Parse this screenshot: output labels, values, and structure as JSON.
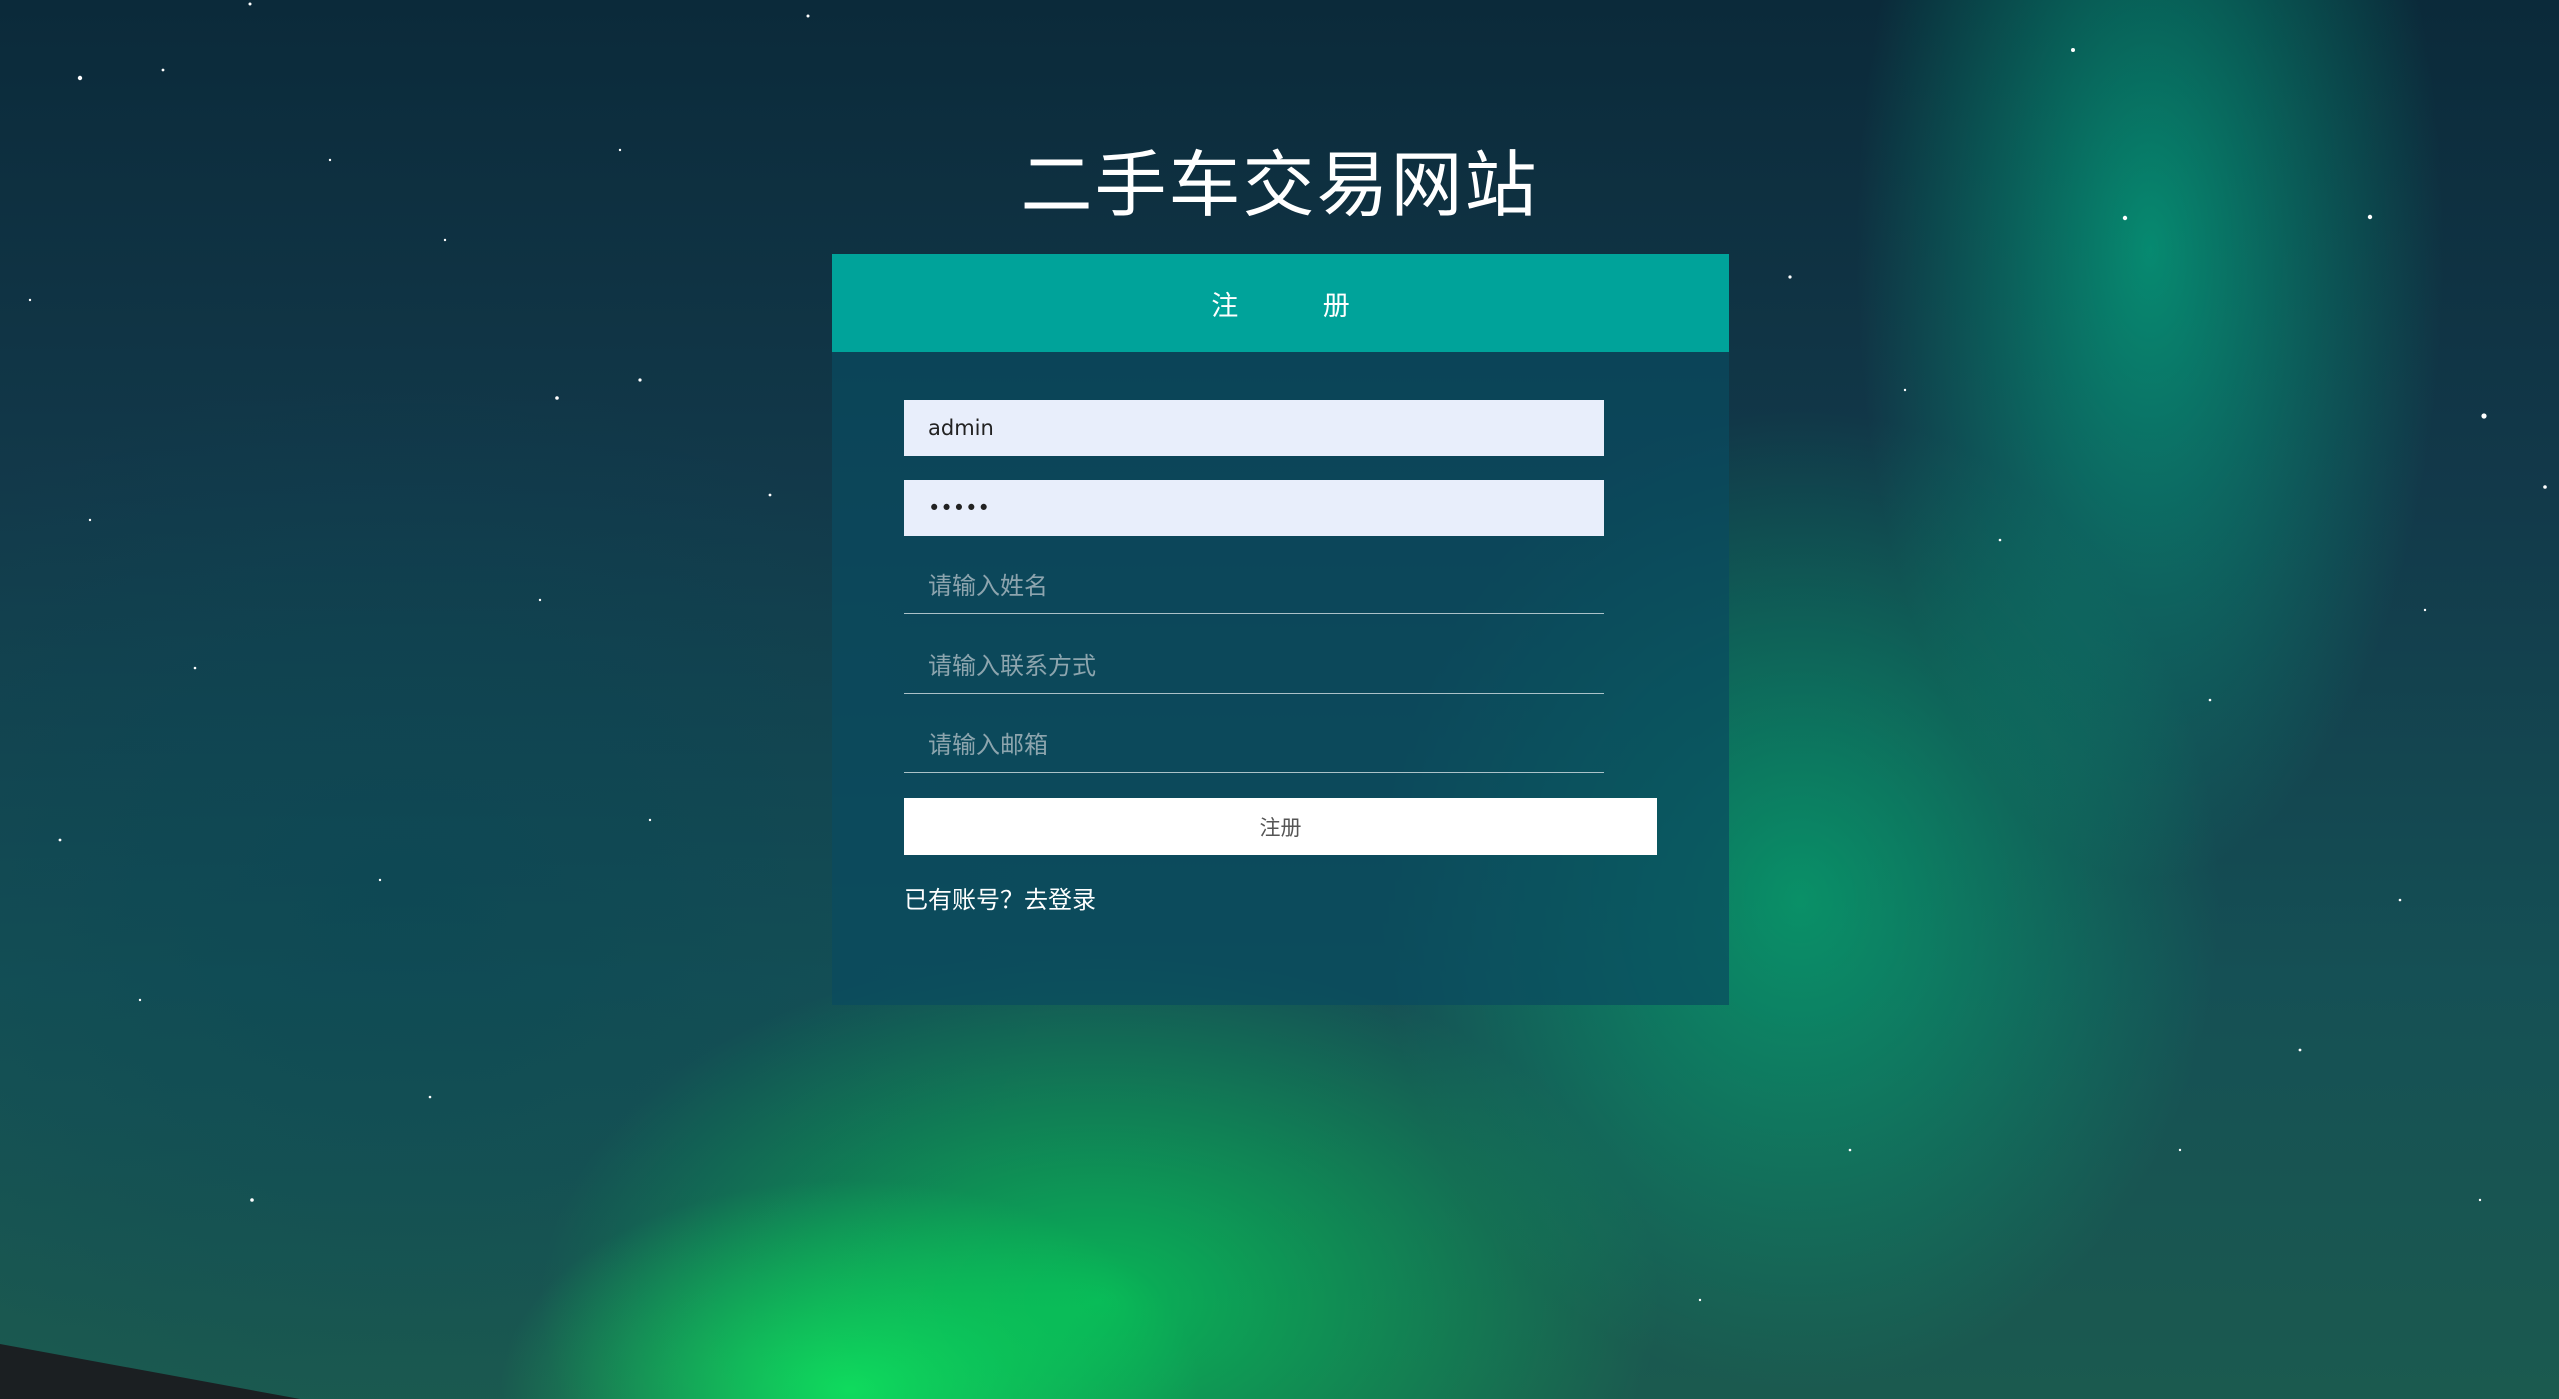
{
  "site": {
    "title": "二手车交易网站"
  },
  "register_card": {
    "header": "注 册",
    "username": {
      "value": "admin"
    },
    "password": {
      "value": "12345"
    },
    "name_field": {
      "placeholder": "请输入姓名",
      "value": ""
    },
    "contact_field": {
      "placeholder": "请输入联系方式",
      "value": ""
    },
    "email_field": {
      "placeholder": "请输入邮箱",
      "value": ""
    },
    "submit_label": "注册",
    "login_link": "已有账号？去登录"
  },
  "colors": {
    "header_teal": "#00a39a",
    "card_bg": "rgba(10,75,95,0.72)",
    "autofill_bg": "#e8eefb"
  }
}
